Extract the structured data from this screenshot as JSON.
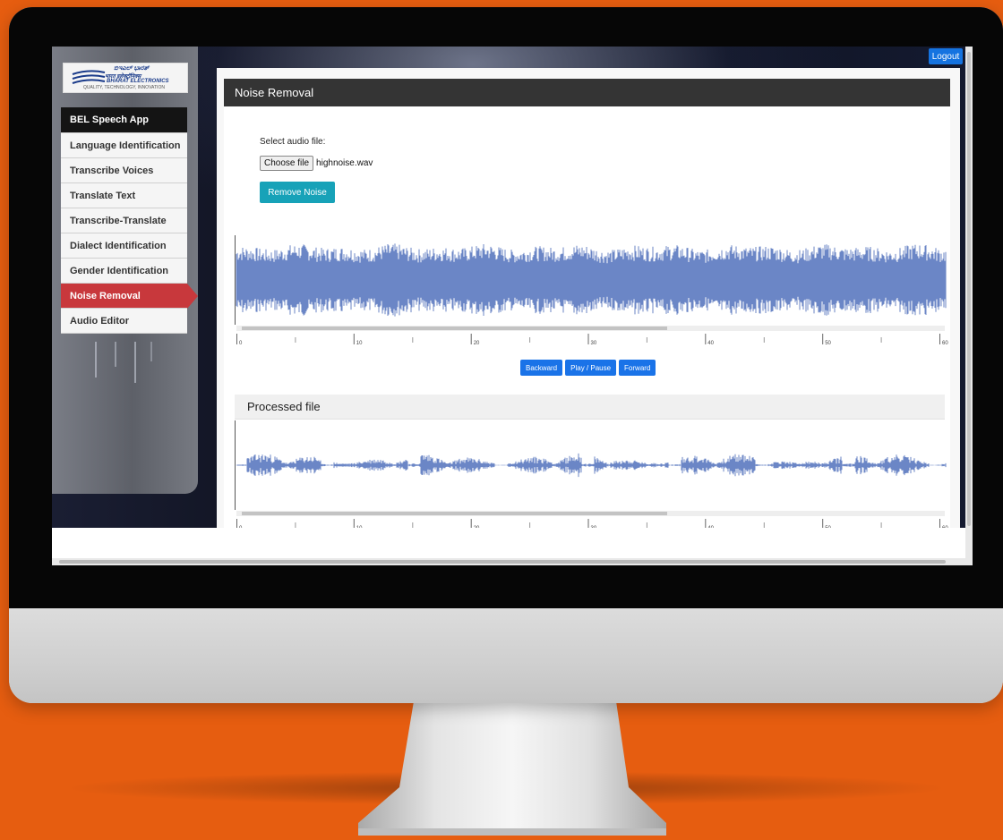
{
  "app": {
    "logout_label": "Logout",
    "logo": {
      "line1": "ಬಿಇಎಲ್ ಭಾರತ್",
      "line2": "भारत इलेक्ट्रॉनिक्स",
      "line3": "BHARAT ELECTRONICS",
      "line4": "QUALITY, TECHNOLOGY, INNOVATION"
    }
  },
  "sidebar": {
    "items": [
      {
        "label": "BEL Speech App",
        "state": "header"
      },
      {
        "label": "Language Identification",
        "state": "normal"
      },
      {
        "label": "Transcribe Voices",
        "state": "normal"
      },
      {
        "label": "Translate Text",
        "state": "normal"
      },
      {
        "label": "Transcribe-Translate",
        "state": "normal"
      },
      {
        "label": "Dialect Identification",
        "state": "normal"
      },
      {
        "label": "Gender Identification",
        "state": "normal"
      },
      {
        "label": "Noise Removal",
        "state": "active"
      },
      {
        "label": "Audio Editor",
        "state": "normal"
      }
    ]
  },
  "main": {
    "title": "Noise Removal",
    "select_label": "Select audio file:",
    "choose_file_label": "Choose file",
    "file_name": "highnoise.wav",
    "remove_noise_label": "Remove Noise",
    "timeline_ticks": [
      "0",
      "10",
      "20",
      "30",
      "40",
      "50",
      "60"
    ],
    "controls": {
      "backward": "Backward",
      "play_pause": "Play / Pause",
      "forward": "Forward"
    },
    "processed_title": "Processed file"
  },
  "colors": {
    "accent": "#1a73e8",
    "remove_button": "#17a2b8",
    "active_nav": "#c8383c",
    "waveform": "#6b86c6",
    "background": "#e65d10"
  }
}
